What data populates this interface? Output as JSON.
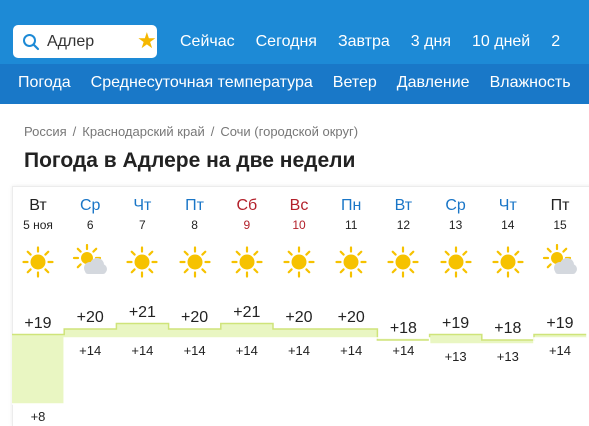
{
  "search": {
    "value": "Адлер"
  },
  "top_nav": [
    "Сейчас",
    "Сегодня",
    "Завтра",
    "3 дня",
    "10 дней",
    "2"
  ],
  "sub_nav": [
    "Погода",
    "Среднесуточная температура",
    "Ветер",
    "Давление",
    "Влажность"
  ],
  "breadcrumbs": [
    "Россия",
    "Краснодарский край",
    "Сочи (городской округ)"
  ],
  "page_title": "Погода в Адлере на две недели",
  "colors": {
    "header": "#1d8ad6",
    "subheader": "#1978c8",
    "weekday": "#1a76c7",
    "weekend": "#b3212b",
    "today": "#222222",
    "fill": "#e9f6c2",
    "line": "#cfe47a",
    "sun": "#f6c200"
  },
  "days": [
    {
      "name": "Вт",
      "date": "5 ноя",
      "kind": "today",
      "icon": "sun-icon"
    },
    {
      "name": "Ср",
      "date": "6",
      "kind": "weekday",
      "icon": "sun-cloud-icon"
    },
    {
      "name": "Чт",
      "date": "7",
      "kind": "weekday",
      "icon": "sun-icon"
    },
    {
      "name": "Пт",
      "date": "8",
      "kind": "weekday",
      "icon": "sun-icon"
    },
    {
      "name": "Сб",
      "date": "9",
      "kind": "weekend",
      "icon": "sun-icon"
    },
    {
      "name": "Вс",
      "date": "10",
      "kind": "weekend",
      "icon": "sun-icon"
    },
    {
      "name": "Пн",
      "date": "11",
      "kind": "weekday",
      "icon": "sun-icon"
    },
    {
      "name": "Вт",
      "date": "12",
      "kind": "weekday",
      "icon": "sun-icon"
    },
    {
      "name": "Ср",
      "date": "13",
      "kind": "weekday",
      "icon": "sun-icon"
    },
    {
      "name": "Чт",
      "date": "14",
      "kind": "weekday",
      "icon": "sun-icon"
    },
    {
      "name": "Пт",
      "date": "15",
      "kind": "today",
      "icon": "sun-cloud-icon"
    }
  ],
  "chart_data": {
    "type": "area",
    "x": [
      "5 ноя",
      "6",
      "7",
      "8",
      "9",
      "10",
      "11",
      "12",
      "13",
      "14",
      "15"
    ],
    "series": [
      {
        "values": [
          19,
          20,
          21,
          20,
          21,
          20,
          20,
          18,
          19,
          18,
          19
        ],
        "labels": [
          "+19",
          "+20",
          "+21",
          "+20",
          "+21",
          "+20",
          "+20",
          "+18",
          "+19",
          "+18",
          "+19"
        ]
      },
      {
        "values": [
          8,
          14,
          14,
          14,
          14,
          14,
          14,
          14,
          13,
          13,
          14
        ],
        "labels": [
          "+8",
          "+14",
          "+14",
          "+14",
          "+14",
          "+14",
          "+14",
          "+14",
          "+13",
          "+13",
          "+14"
        ]
      }
    ]
  }
}
